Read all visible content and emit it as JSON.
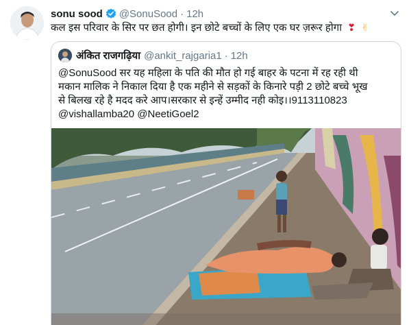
{
  "tweet": {
    "author_name": "sonu sood",
    "author_handle": "@SonuSood",
    "separator": "·",
    "time": "12h",
    "text": "कल इस परिवार के सिर पर छत होगी। इन छोटे बच्चों के लिए एक घर ज़रूर होगा",
    "emoji_heart": "❣",
    "emoji_peace": "✌"
  },
  "icons": {
    "verified": "verified-badge-icon",
    "menu": "chevron-down-icon"
  },
  "quoted": {
    "author_name": "अंकित राजगढ़िया",
    "author_handle": "@ankit_rajgaria1",
    "separator": "·",
    "time": "12h",
    "lines": [
      "@SonuSood  सर यह महिला के पति की मौत हो गई बाहर के पटना में रह रही थी",
      "मकान मालिक ने निकाल दिया है एक महीने से सड़कों के किनारे पड़ी 2 छोटे बच्चे भूख",
      "से बिलख रहे है मदद करे आप।सरकार से इन्हें उम्मीद नही कोइ।।9113110823",
      "@vishallamba20 @NeetiGoel2"
    ]
  },
  "colors": {
    "link": "#1b95e0",
    "verified": "#1da1f2",
    "muted": "#657786",
    "border": "#ccd6dd"
  }
}
